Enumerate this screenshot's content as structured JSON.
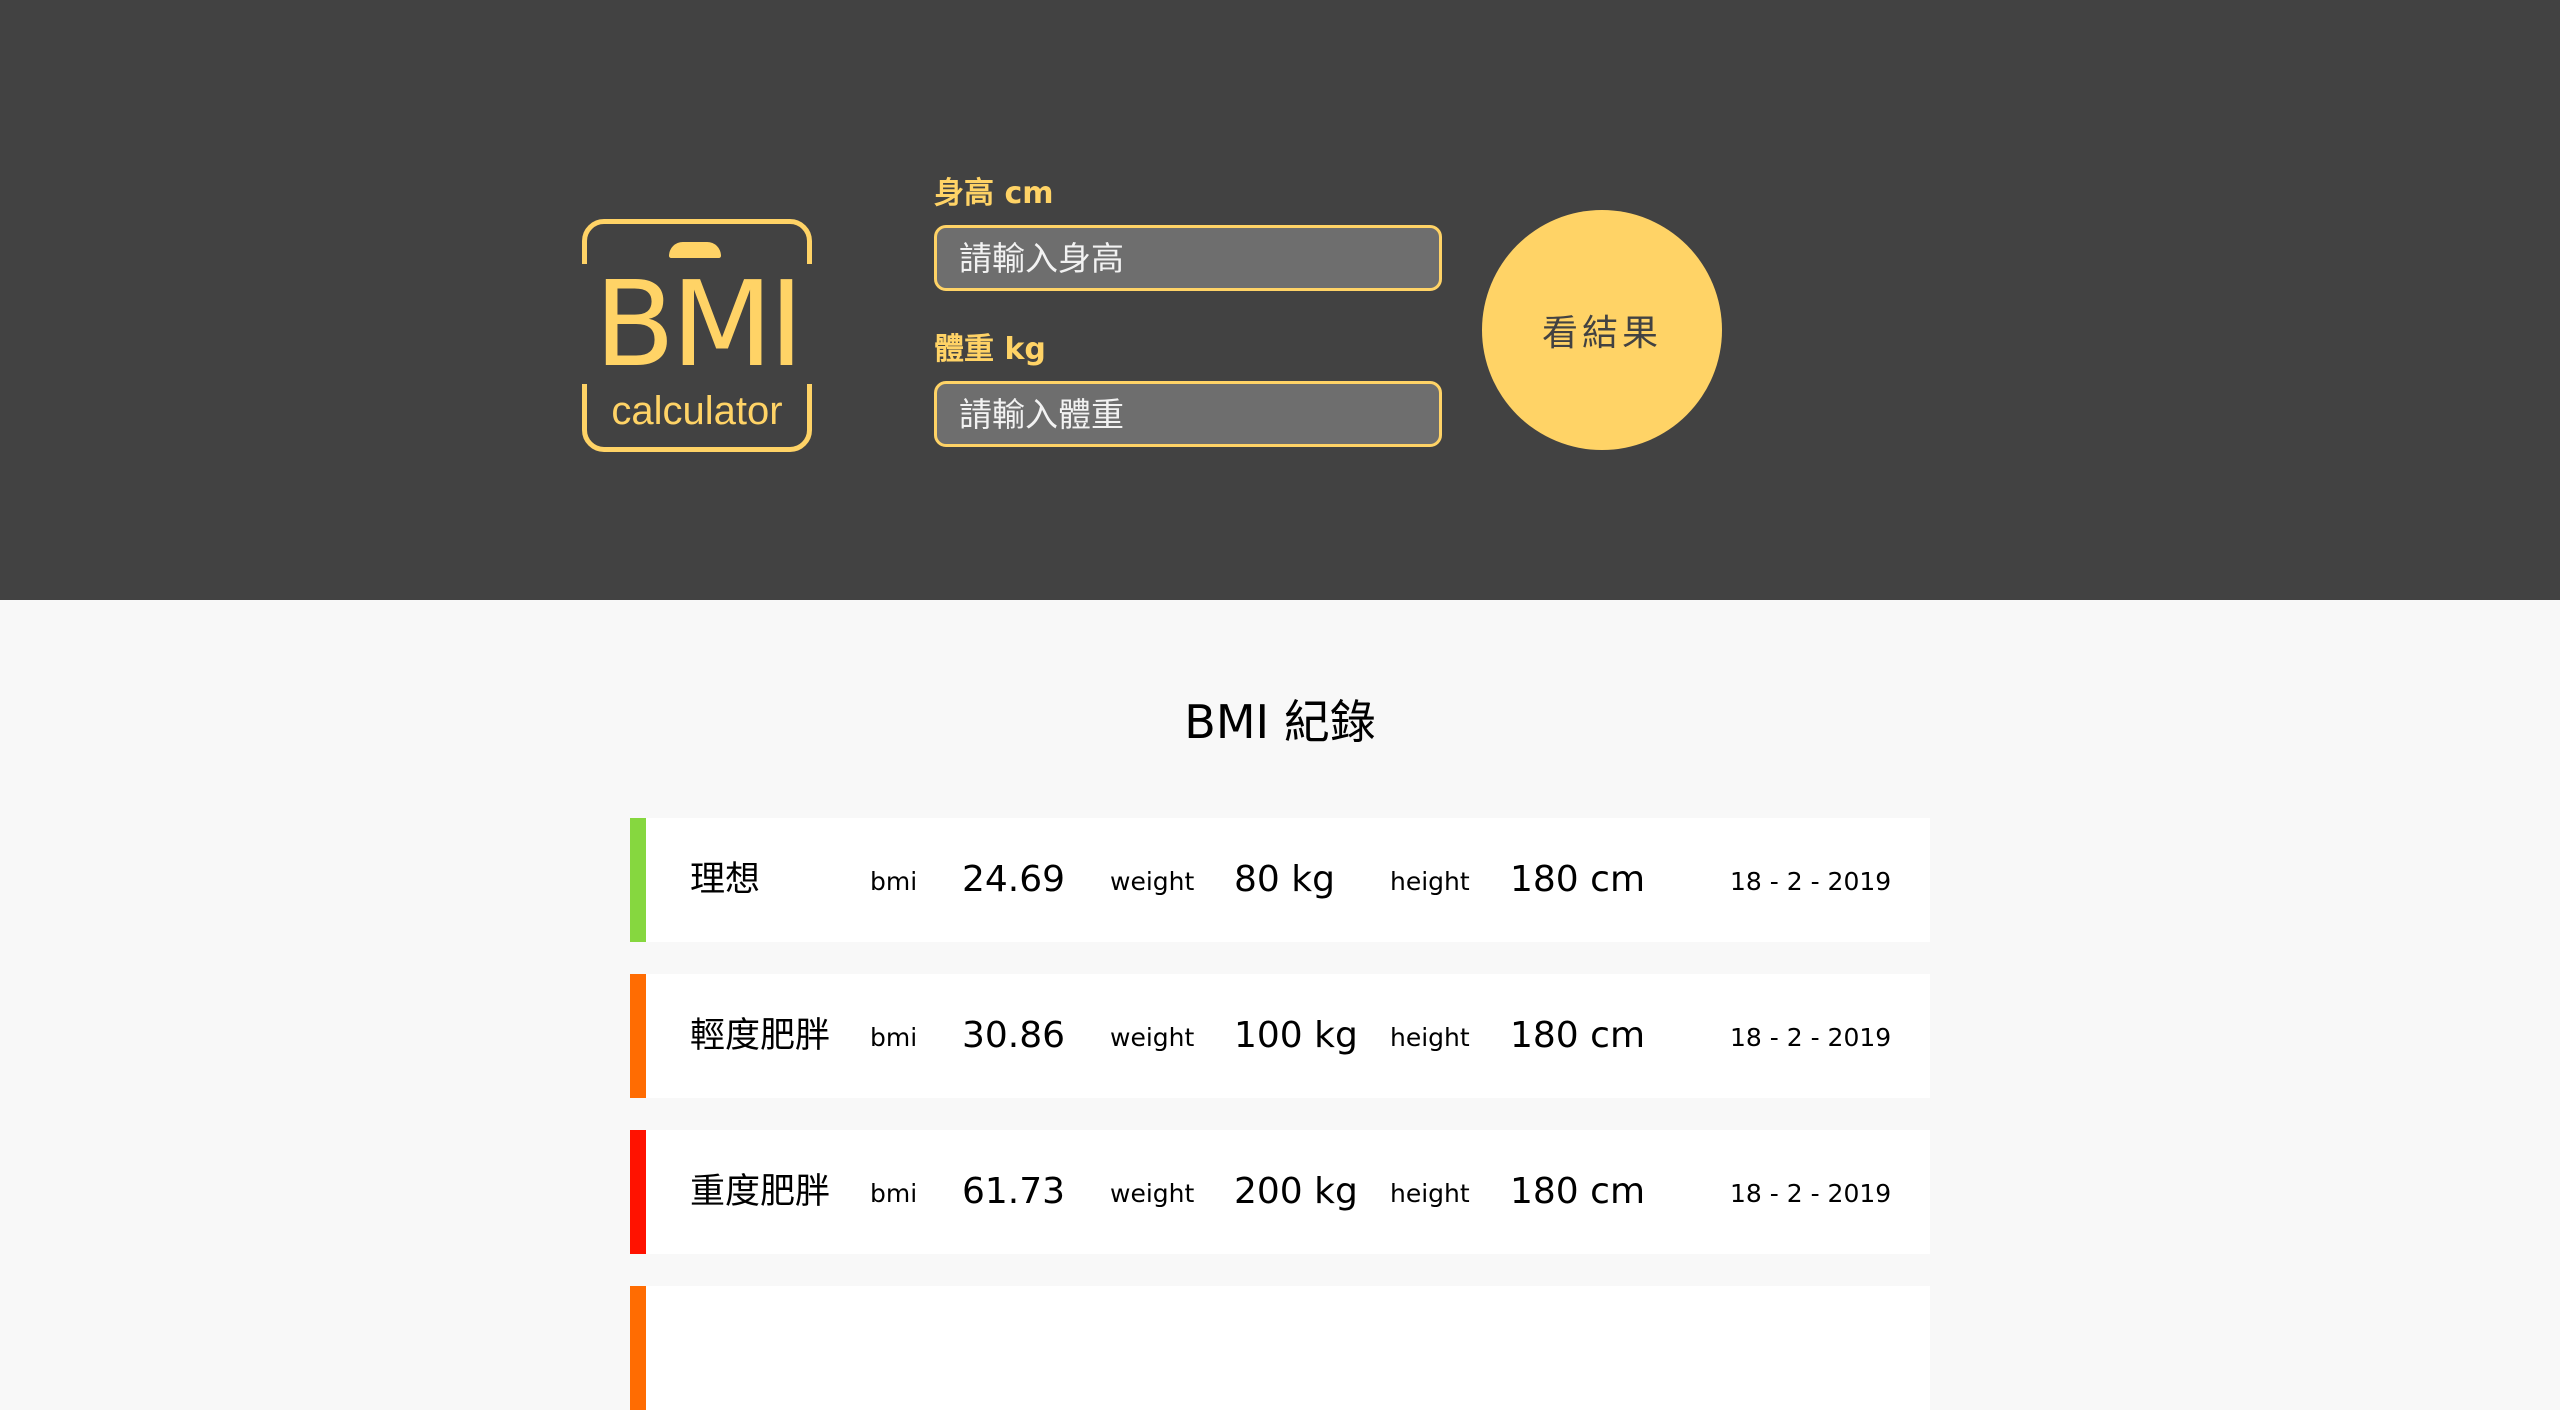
{
  "logo": {
    "main_text": "BMI",
    "sub_text": "calculator"
  },
  "form": {
    "height_label": "身高 cm",
    "height_placeholder": "請輸入身高",
    "weight_label": "體重 kg",
    "weight_placeholder": "請輸入體重",
    "submit_label": "看結果"
  },
  "records": {
    "title": "BMI 紀錄",
    "bmi_label": "bmi",
    "weight_label": "weight",
    "height_label": "height",
    "items": [
      {
        "status": "理想",
        "bmi": "24.69",
        "weight": "80 kg",
        "height": "180 cm",
        "date": "18 - 2 - 2019",
        "color": "#86d73f"
      },
      {
        "status": "輕度肥胖",
        "bmi": "30.86",
        "weight": "100 kg",
        "height": "180 cm",
        "date": "18 - 2 - 2019",
        "color": "#ff6c02"
      },
      {
        "status": "重度肥胖",
        "bmi": "61.73",
        "weight": "200 kg",
        "height": "180 cm",
        "date": "18 - 2 - 2019",
        "color": "#ff1200"
      },
      {
        "status": "",
        "bmi": "",
        "weight": "",
        "height": "",
        "date": "",
        "color": "#ff6c02"
      }
    ]
  }
}
